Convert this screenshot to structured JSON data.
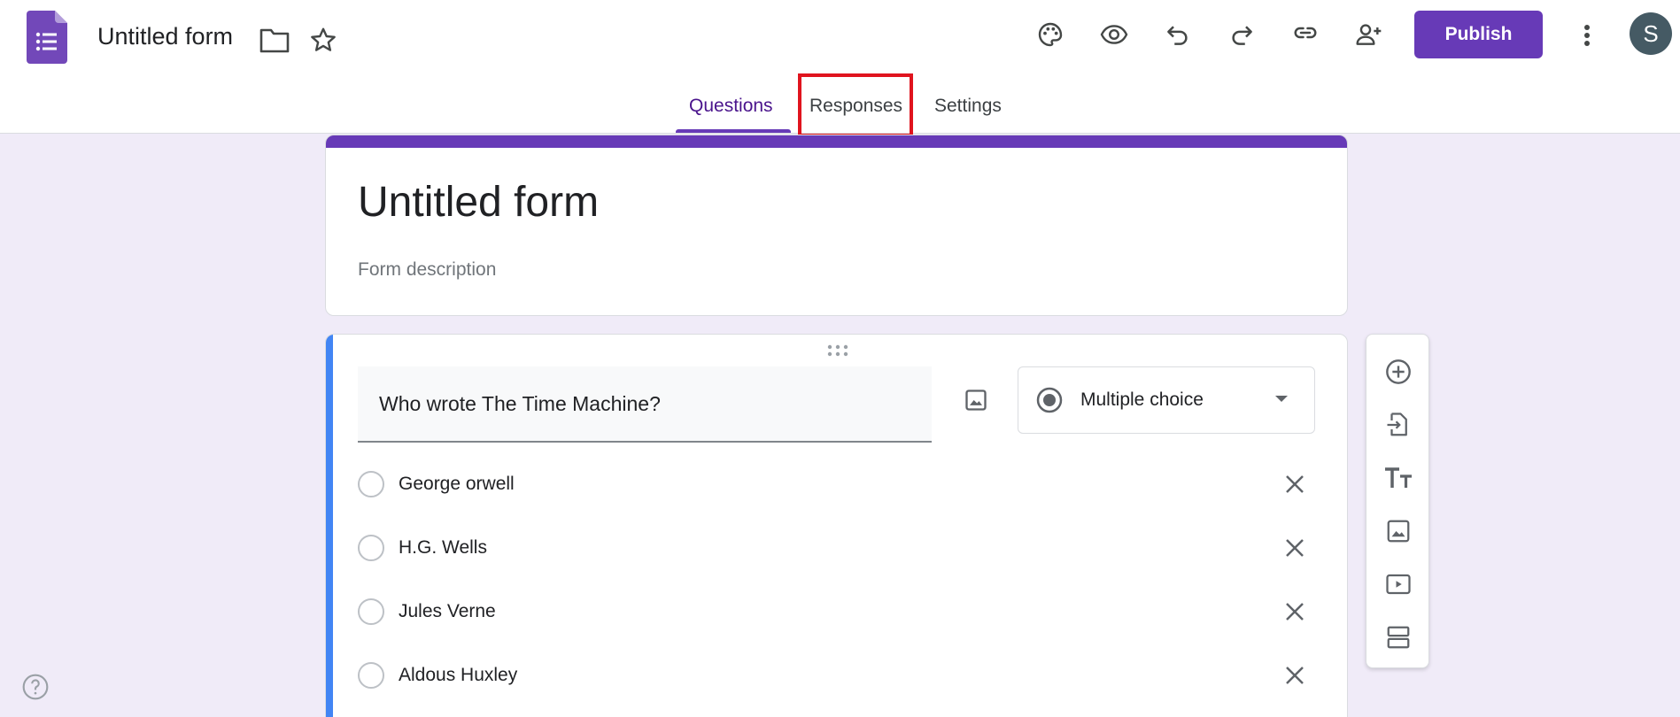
{
  "header": {
    "doc_title": "Untitled form",
    "publish_label": "Publish",
    "avatar_letter": "S",
    "icons": [
      "forms-app-icon",
      "folder-icon",
      "star-icon",
      "palette-icon",
      "eye-icon",
      "undo-icon",
      "redo-icon",
      "link-icon",
      "add-collaborator-icon",
      "more-vert-icon"
    ]
  },
  "tabs": [
    {
      "label": "Questions",
      "active": true
    },
    {
      "label": "Responses",
      "active": false
    },
    {
      "label": "Settings",
      "active": false
    }
  ],
  "form": {
    "title": "Untitled form",
    "description_placeholder": "Form description"
  },
  "question": {
    "text": "Who wrote The Time Machine?",
    "type": "Multiple choice",
    "options": [
      {
        "label": "George orwell"
      },
      {
        "label": "H.G. Wells"
      },
      {
        "label": "Jules Verne"
      },
      {
        "label": "Aldous Huxley"
      }
    ]
  },
  "toolbar": {
    "items": [
      "add-question-icon",
      "import-questions-icon",
      "add-title-icon",
      "add-image-icon",
      "add-video-icon",
      "add-section-icon"
    ]
  },
  "colors": {
    "accent": "#673ab7",
    "background": "#f0ebf8",
    "question_accent": "#4285f4",
    "highlight": "#e0141e"
  }
}
